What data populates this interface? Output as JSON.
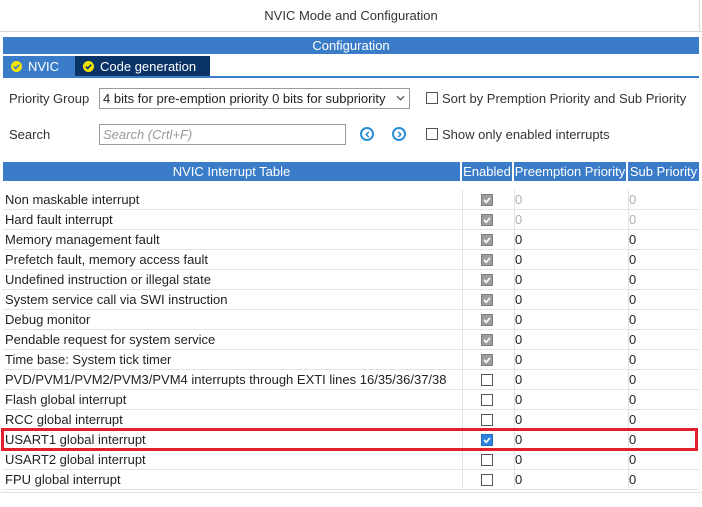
{
  "window": {
    "title": "NVIC Mode and Configuration"
  },
  "section": {
    "title": "Configuration"
  },
  "tabs": [
    {
      "label": "NVIC",
      "icon": "check-circle-icon"
    },
    {
      "label": "Code generation",
      "icon": "check-circle-icon"
    }
  ],
  "priority_group": {
    "label": "Priority Group",
    "value": "4 bits for pre-emption priority 0 bits for subpriority"
  },
  "sort_option": {
    "label": "Sort by Premption Priority and Sub Priority",
    "checked": false
  },
  "search": {
    "label": "Search",
    "placeholder": "Search (Crtl+F)"
  },
  "show_enabled_option": {
    "label": "Show only enabled interrupts",
    "checked": false
  },
  "table": {
    "columns": [
      "NVIC Interrupt Table",
      "Enabled",
      "Preemption Priority",
      "Sub Priority"
    ],
    "rows": [
      {
        "name": "Non maskable interrupt",
        "enabled": true,
        "preemption": "0",
        "sub": "0"
      },
      {
        "name": "Hard fault interrupt",
        "enabled": true,
        "preemption": "0",
        "sub": "0"
      },
      {
        "name": "Memory management fault",
        "enabled": true,
        "preemption": "0",
        "sub": "0"
      },
      {
        "name": "Prefetch fault, memory access fault",
        "enabled": true,
        "preemption": "0",
        "sub": "0"
      },
      {
        "name": "Undefined instruction or illegal state",
        "enabled": true,
        "preemption": "0",
        "sub": "0"
      },
      {
        "name": "System service call via SWI instruction",
        "enabled": true,
        "preemption": "0",
        "sub": "0"
      },
      {
        "name": "Debug monitor",
        "enabled": true,
        "preemption": "0",
        "sub": "0"
      },
      {
        "name": "Pendable request for system service",
        "enabled": true,
        "preemption": "0",
        "sub": "0"
      },
      {
        "name": "Time base: System tick timer",
        "enabled": true,
        "preemption": "0",
        "sub": "0"
      },
      {
        "name": "PVD/PVM1/PVM2/PVM3/PVM4 interrupts through EXTI lines 16/35/36/37/38",
        "enabled": false,
        "preemption": "0",
        "sub": "0"
      },
      {
        "name": "Flash global interrupt",
        "enabled": false,
        "preemption": "0",
        "sub": "0"
      },
      {
        "name": "RCC global interrupt",
        "enabled": false,
        "preemption": "0",
        "sub": "0"
      },
      {
        "name": "USART1 global interrupt",
        "enabled": true,
        "preemption": "0",
        "sub": "0"
      },
      {
        "name": "USART2 global interrupt",
        "enabled": false,
        "preemption": "0",
        "sub": "0"
      },
      {
        "name": "FPU global interrupt",
        "enabled": false,
        "preemption": "0",
        "sub": "0"
      }
    ]
  },
  "colors": {
    "header_blue": "#3b7cc9",
    "active_tab": "#0a3468",
    "highlight": "#e0202a",
    "checkbox_blue": "#2e84dd"
  }
}
